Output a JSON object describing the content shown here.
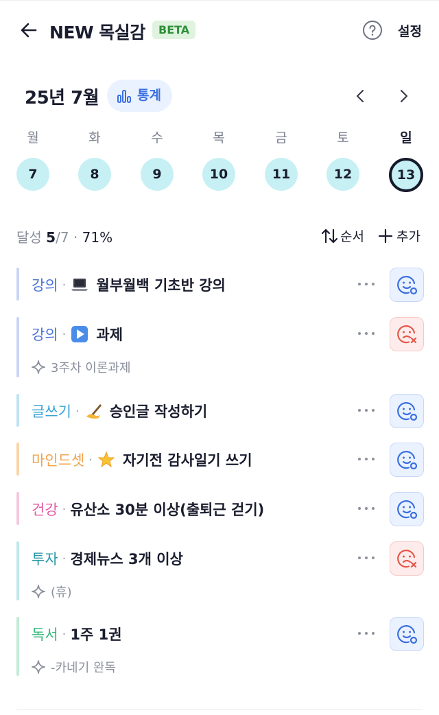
{
  "header": {
    "title": "NEW 목실감",
    "badge": "BETA",
    "settings_label": "설정",
    "back_icon": "arrow-left-icon",
    "help_icon": "question-circle-icon"
  },
  "calendar": {
    "month_label": "25년 7월",
    "stats_label": "통계",
    "days": [
      {
        "name": "월",
        "date": "7"
      },
      {
        "name": "화",
        "date": "8"
      },
      {
        "name": "수",
        "date": "9"
      },
      {
        "name": "목",
        "date": "10"
      },
      {
        "name": "금",
        "date": "11"
      },
      {
        "name": "토",
        "date": "12"
      },
      {
        "name": "일",
        "date": "13",
        "selected": true
      }
    ]
  },
  "summary": {
    "label": "달성",
    "done": "5",
    "total": "/7",
    "sep": "·",
    "percent": "71%",
    "sort_label": "순서",
    "add_label": "추가"
  },
  "colors": {
    "lecture": "#4b74d8",
    "writing": "#3aa3d6",
    "mindset": "#f2a34a",
    "health": "#e65aa3",
    "invest": "#2a9aa8",
    "reading": "#34b77c"
  },
  "items": [
    {
      "category": "강의",
      "sep": "·",
      "emoji": "laptop-icon",
      "title": "월부월백 기초반 강의",
      "note": "",
      "status": "success"
    },
    {
      "category": "강의",
      "sep": "·",
      "emoji": "play-button-icon",
      "title": "과제",
      "note": "3주차 이론과제",
      "status": "fail"
    },
    {
      "category": "글쓰기",
      "sep": "·",
      "emoji": "writing-hand-icon",
      "title": "승인글 작성하기",
      "note": "",
      "status": "success"
    },
    {
      "category": "마인드셋",
      "sep": "·",
      "emoji": "glowing-star-icon",
      "title": "자기전 감사일기 쓰기",
      "note": "",
      "status": "success"
    },
    {
      "category": "건강",
      "sep": "·",
      "emoji": "",
      "title": "유산소 30분 이상(출퇴근 걷기)",
      "note": "",
      "status": "success"
    },
    {
      "category": "투자",
      "sep": "·",
      "emoji": "",
      "title": "경제뉴스 3개 이상",
      "note": "(휴)",
      "status": "fail"
    },
    {
      "category": "독서",
      "sep": "·",
      "emoji": "",
      "title": "1주 1권",
      "note": "-카네기 완독",
      "status": "success"
    }
  ]
}
